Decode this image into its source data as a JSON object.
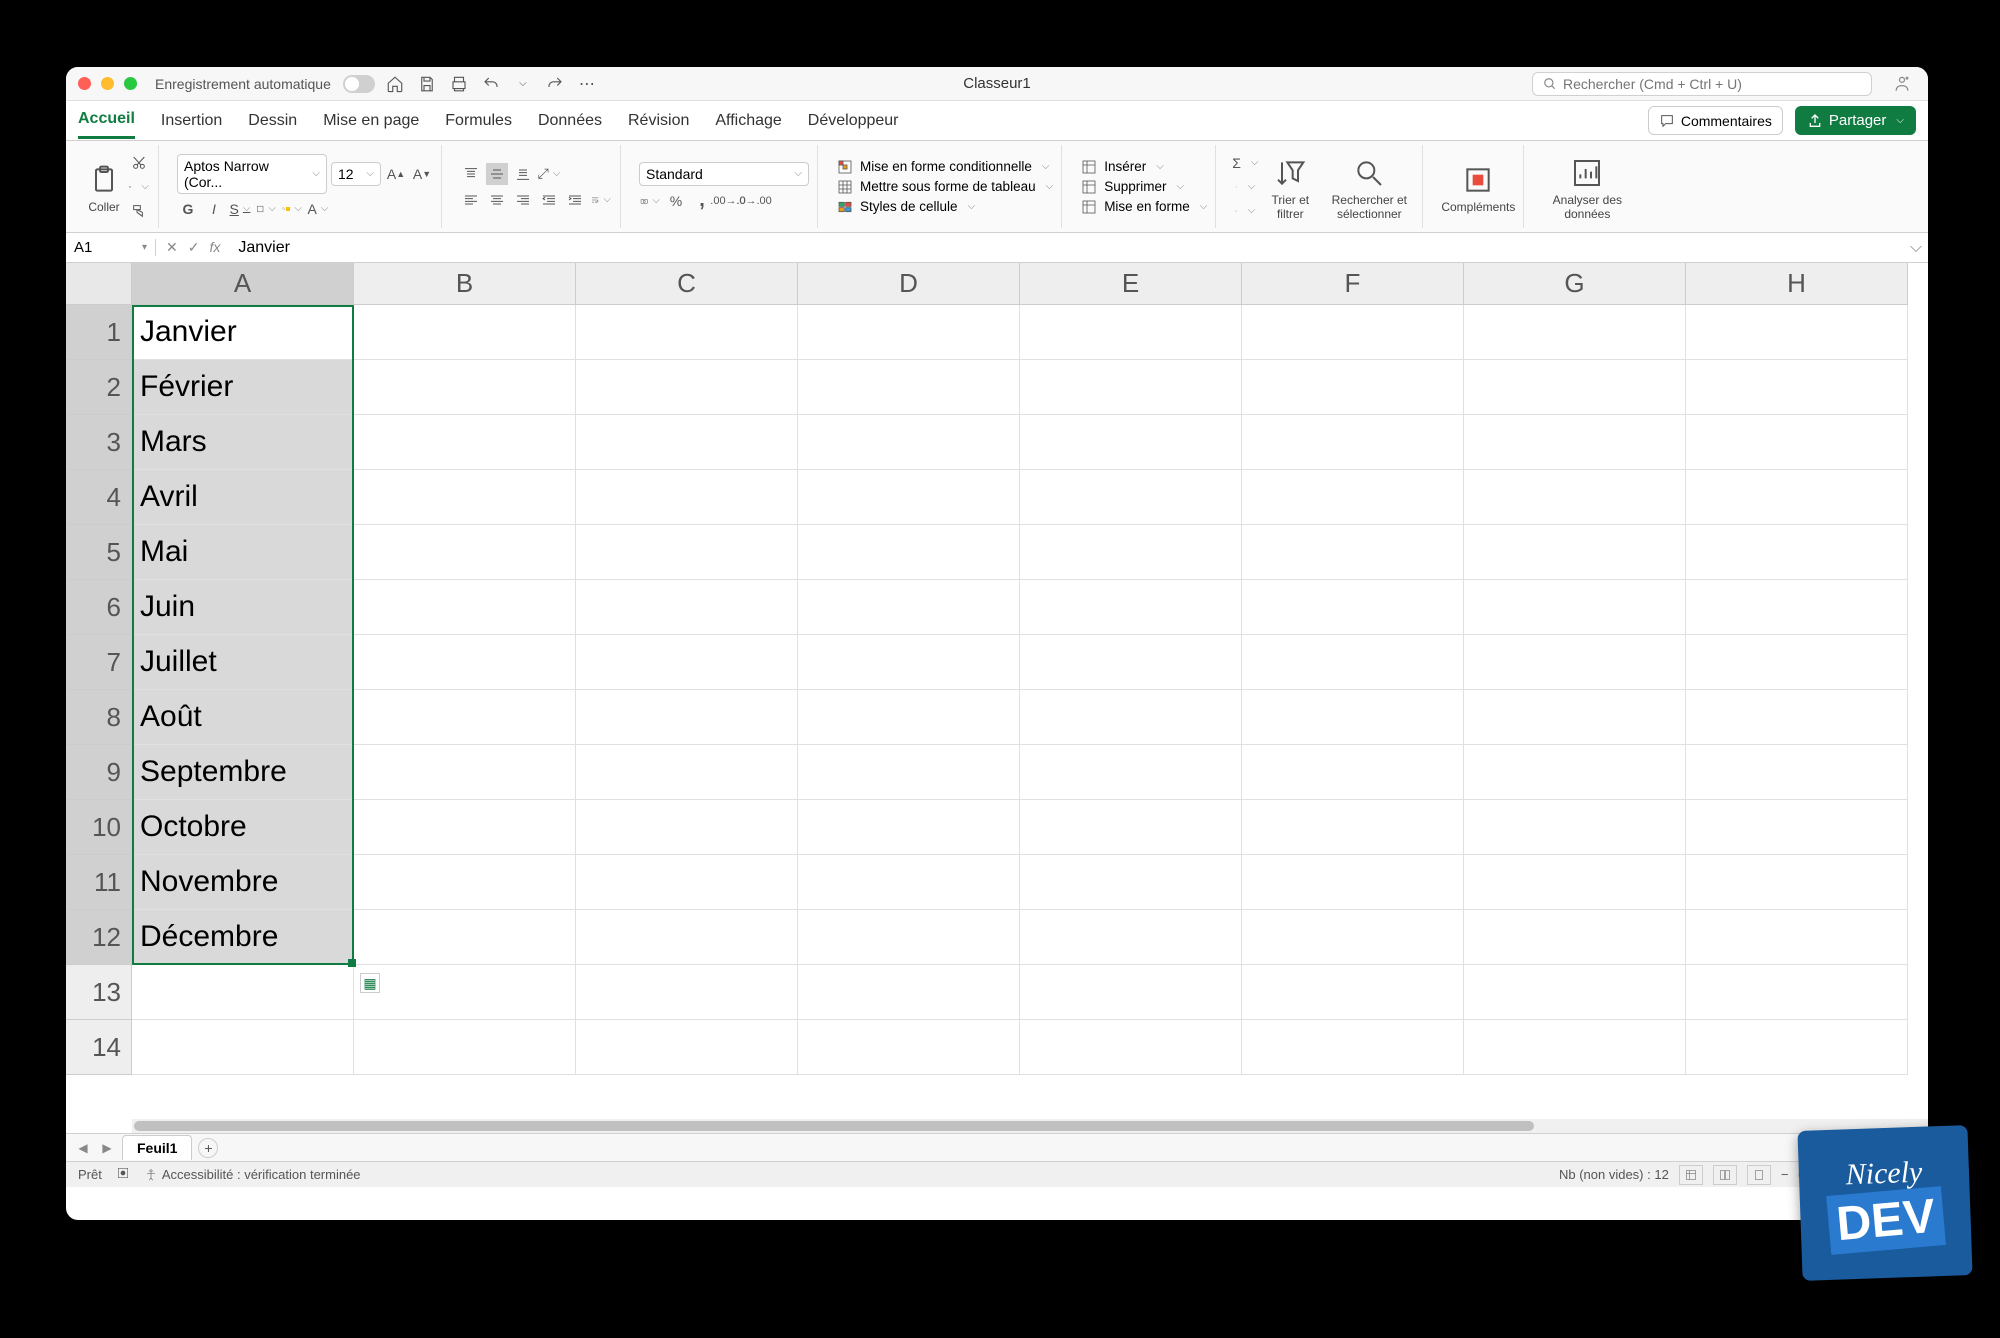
{
  "titlebar": {
    "autosave_label": "Enregistrement automatique",
    "doc_title": "Classeur1",
    "search_placeholder": "Rechercher (Cmd + Ctrl + U)"
  },
  "tabs": {
    "list": [
      "Accueil",
      "Insertion",
      "Dessin",
      "Mise en page",
      "Formules",
      "Données",
      "Révision",
      "Affichage",
      "Développeur"
    ],
    "comments": "Commentaires",
    "share": "Partager"
  },
  "ribbon": {
    "paste_label": "Coller",
    "font_name": "Aptos Narrow (Cor...",
    "font_size": "12",
    "number_format": "Standard",
    "cond_format": "Mise en forme conditionnelle",
    "as_table": "Mettre sous forme de tableau",
    "cell_styles": "Styles de cellule",
    "insert": "Insérer",
    "delete": "Supprimer",
    "format": "Mise en forme",
    "sort_filter": "Trier et filtrer",
    "find_select": "Rechercher et sélectionner",
    "addins": "Compléments",
    "analyze": "Analyser des données"
  },
  "formula_bar": {
    "name_box": "A1",
    "fx_value": "Janvier"
  },
  "grid": {
    "columns": [
      "A",
      "B",
      "C",
      "D",
      "E",
      "F",
      "G",
      "H"
    ],
    "selected_col": "A",
    "rows": [
      {
        "n": "1",
        "a": "Janvier"
      },
      {
        "n": "2",
        "a": "Février"
      },
      {
        "n": "3",
        "a": "Mars"
      },
      {
        "n": "4",
        "a": "Avril"
      },
      {
        "n": "5",
        "a": "Mai"
      },
      {
        "n": "6",
        "a": "Juin"
      },
      {
        "n": "7",
        "a": "Juillet"
      },
      {
        "n": "8",
        "a": "Août"
      },
      {
        "n": "9",
        "a": "Septembre"
      },
      {
        "n": "10",
        "a": "Octobre"
      },
      {
        "n": "11",
        "a": "Novembre"
      },
      {
        "n": "12",
        "a": "Décembre"
      },
      {
        "n": "13",
        "a": ""
      },
      {
        "n": "14",
        "a": ""
      }
    ],
    "selected_rows": 12
  },
  "sheets": {
    "active": "Feuil1"
  },
  "status": {
    "ready": "Prêt",
    "accessibility": "Accessibilité : vérification terminée",
    "count": "Nb (non vides) : 12"
  },
  "brand": {
    "l1": "Nicely",
    "l2": "DEV"
  }
}
